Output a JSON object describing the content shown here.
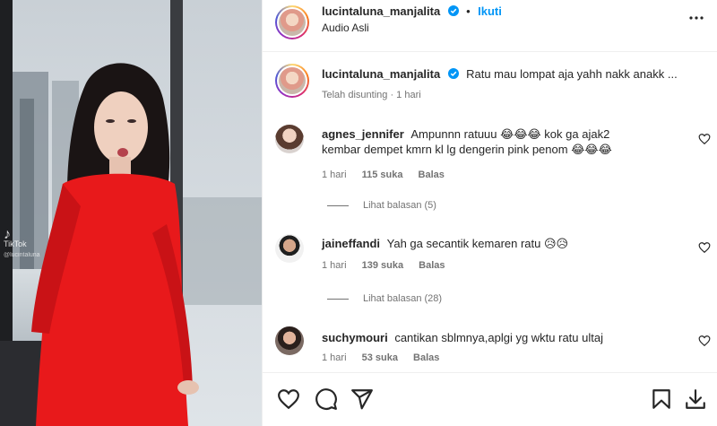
{
  "media": {
    "watermark_glyph": "♪",
    "watermark_text": "TikTok",
    "watermark_user": "@lucintaluna"
  },
  "header": {
    "username": "lucintaluna_manjalita",
    "separator": "•",
    "follow_label": "Ikuti",
    "audio": "Audio Asli"
  },
  "caption": {
    "username": "lucintaluna_manjalita",
    "text": "Ratu mau lompat aja yahh nakk anakk ...",
    "meta": "Telah disunting · 1 hari"
  },
  "comments": [
    {
      "username": "agnes_jennifer",
      "text_line1": "Ampunnn ratuuu 😂😂😂 kok ga ajak2",
      "text_line2": "kembar dempet kmrn kl lg dengerin pink penom 😂😂😂",
      "time": "1 hari",
      "likes": "115 suka",
      "reply": "Balas",
      "view_replies": "Lihat balasan (5)"
    },
    {
      "username": "jaineffandi",
      "text_line1": "Yah ga secantik kemaren ratu 😥😥",
      "time": "1 hari",
      "likes": "139 suka",
      "reply": "Balas",
      "view_replies": "Lihat balasan (28)"
    },
    {
      "username": "suchymouri",
      "text_line1": "cantikan sblmnya,aplgi yg wktu ratu ultaj",
      "time": "1 hari",
      "likes": "53 suka",
      "reply": "Balas"
    }
  ],
  "colors": {
    "accent": "#0095f6",
    "verified": "#0095f6",
    "dress": "#e8191b",
    "muted": "#737373"
  },
  "icons": [
    "more-icon",
    "verified-icon",
    "heart-icon",
    "comment-icon",
    "share-icon",
    "bookmark-icon",
    "download-icon"
  ]
}
